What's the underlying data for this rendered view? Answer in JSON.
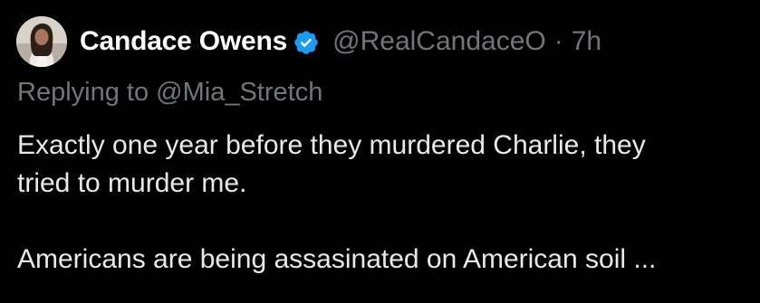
{
  "tweet": {
    "author": {
      "display_name": "Candace Owens",
      "handle": "@RealCandaceO",
      "verified": true,
      "avatar_icon": "profile-photo"
    },
    "separator": "·",
    "timestamp": "7h",
    "reply_prefix": "Replying to ",
    "reply_to": "@Mia_Stretch",
    "text_lines": [
      "Exactly one year before they murdered Charlie, they",
      "tried to murder me.",
      "",
      "Americans are being assasinated on American soil ..."
    ]
  },
  "colors": {
    "background": "#000000",
    "primary_text": "#e7e9ea",
    "secondary_text": "#71767b",
    "verified_badge": "#1d9bf0"
  }
}
